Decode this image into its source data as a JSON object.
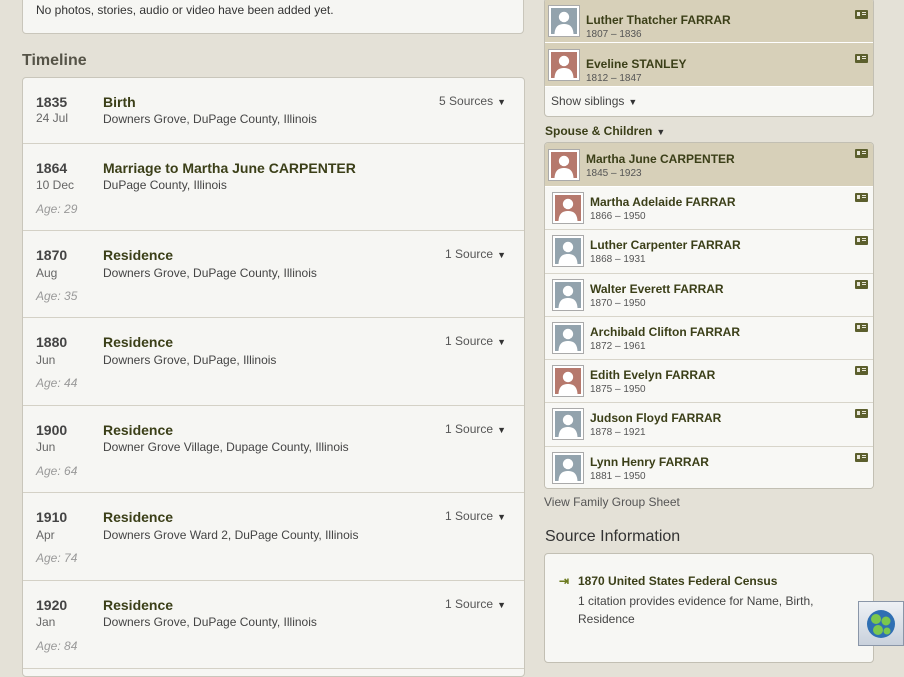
{
  "media": {
    "empty_text": "No photos, stories, audio or video have been added yet."
  },
  "timeline": {
    "title": "Timeline",
    "events": [
      {
        "year": "1835",
        "date": "24 Jul",
        "title": "Birth",
        "place": "Downers Grove, DuPage County, Illinois",
        "sources": "5 Sources",
        "age": ""
      },
      {
        "year": "1864",
        "date": "10 Dec",
        "title": "Marriage to Martha June CARPENTER",
        "place": "DuPage County, Illinois",
        "sources": "",
        "age": "Age: 29"
      },
      {
        "year": "1870",
        "date": "Aug",
        "title": "Residence",
        "place": "Downers Grove, DuPage County, Illinois",
        "sources": "1 Source",
        "age": "Age: 35"
      },
      {
        "year": "1880",
        "date": "Jun",
        "title": "Residence",
        "place": "Downers Grove, DuPage, Illinois",
        "sources": "1 Source",
        "age": "Age: 44"
      },
      {
        "year": "1900",
        "date": "Jun",
        "title": "Residence",
        "place": "Downer Grove Village, Dupage County, Illinois",
        "sources": "1 Source",
        "age": "Age: 64"
      },
      {
        "year": "1910",
        "date": "Apr",
        "title": "Residence",
        "place": "Downers Grove Ward 2, DuPage County, Illinois",
        "sources": "1 Source",
        "age": "Age: 74"
      },
      {
        "year": "1920",
        "date": "Jan",
        "title": "Residence",
        "place": "Downers Grove, DuPage County, Illinois",
        "sources": "1 Source",
        "age": "Age: 84"
      }
    ]
  },
  "parents": [
    {
      "name": "Luther Thatcher FARRAR",
      "dates": "1807 – 1836",
      "gender": "m"
    },
    {
      "name": "Eveline STANLEY",
      "dates": "1812 – 1847",
      "gender": "f"
    }
  ],
  "show_siblings": "Show siblings",
  "spouse_label": "Spouse & Children",
  "spouse": {
    "name": "Martha June CARPENTER",
    "dates": "1845 – 1923",
    "gender": "f"
  },
  "children": [
    {
      "name": "Martha Adelaide FARRAR",
      "dates": "1866 – 1950",
      "gender": "f"
    },
    {
      "name": "Luther Carpenter FARRAR",
      "dates": "1868 – 1931",
      "gender": "m"
    },
    {
      "name": "Walter Everett FARRAR",
      "dates": "1870 – 1950",
      "gender": "m"
    },
    {
      "name": "Archibald Clifton FARRAR",
      "dates": "1872 – 1961",
      "gender": "m"
    },
    {
      "name": "Edith Evelyn FARRAR",
      "dates": "1875 – 1950",
      "gender": "f"
    },
    {
      "name": "Judson Floyd FARRAR",
      "dates": "1878 – 1921",
      "gender": "m"
    },
    {
      "name": "Lynn Henry FARRAR",
      "dates": "1881 – 1950",
      "gender": "m"
    }
  ],
  "view_family_group_sheet": "View Family Group Sheet",
  "source_info": {
    "title": "Source Information",
    "source_name": "1870 United States Federal Census",
    "description": "1 citation provides evidence for Name, Birth, Residence"
  },
  "icons": {
    "caret": "caret-down-icon",
    "person": "person-silhouette-icon",
    "card": "family-card-icon",
    "source": "source-arrow-icon",
    "badge": "app-badge-icon"
  },
  "colors": {
    "male_avatar": "#93a3ad",
    "female_avatar": "#b6796d",
    "highlight_row": "#d7d0b9",
    "link_text": "#3b3f18"
  }
}
